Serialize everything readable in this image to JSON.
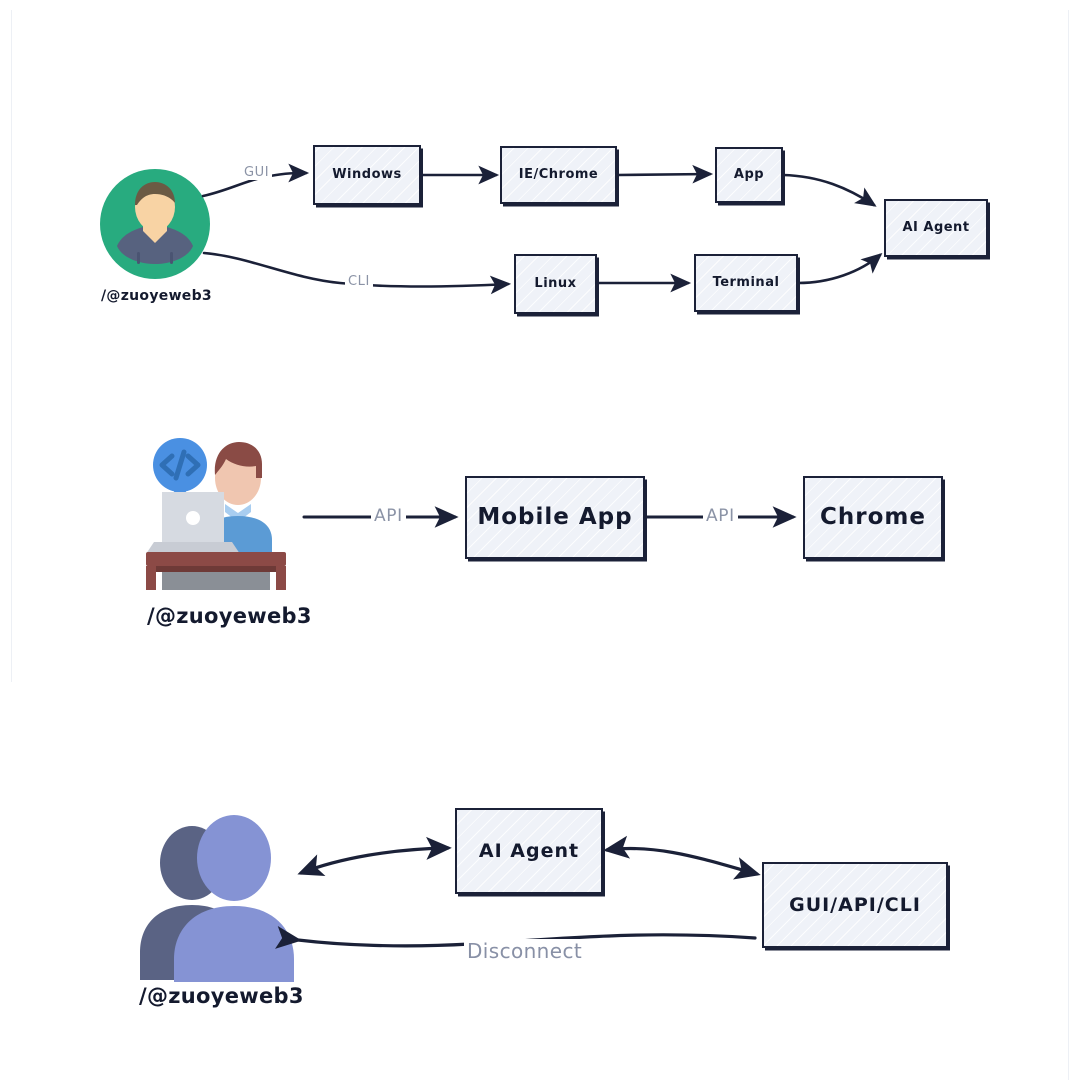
{
  "page": {
    "background": "#ffffff",
    "rail_color": "#edf0f5",
    "node_fill": "#eff2f8",
    "node_stroke": "#1b2138",
    "label_color": "#8b93a6",
    "text_color": "#141a2e"
  },
  "diagrams": [
    {
      "id": "gui-cli-flow",
      "avatar": {
        "type": "circle-user-avatar",
        "caption": "/@zuoyeweb3",
        "colors": {
          "circle": "#28ab7f",
          "hair": "#6b5a44",
          "skin": "#f8d3a4",
          "body": "#57627f"
        }
      },
      "nodes": [
        {
          "id": "windows",
          "label": "Windows"
        },
        {
          "id": "ie-chrome",
          "label": "IE/Chrome"
        },
        {
          "id": "app",
          "label": "App"
        },
        {
          "id": "linux",
          "label": "Linux"
        },
        {
          "id": "terminal",
          "label": "Terminal"
        },
        {
          "id": "ai-agent",
          "label": "AI Agent"
        }
      ],
      "edges": [
        {
          "from": "user",
          "to": "windows",
          "label": "GUI"
        },
        {
          "from": "windows",
          "to": "ie-chrome",
          "label": ""
        },
        {
          "from": "ie-chrome",
          "to": "app",
          "label": ""
        },
        {
          "from": "app",
          "to": "ai-agent",
          "label": ""
        },
        {
          "from": "user",
          "to": "linux",
          "label": "CLI"
        },
        {
          "from": "linux",
          "to": "terminal",
          "label": ""
        },
        {
          "from": "terminal",
          "to": "ai-agent",
          "label": ""
        }
      ]
    },
    {
      "id": "api-flow",
      "avatar": {
        "type": "developer-at-desk-avatar",
        "caption": "/@zuoyeweb3",
        "badge": "code-bubble-icon",
        "colors": {
          "bubble": "#4a90e2",
          "laptop": "#d6dae1",
          "desk": "#8c4a46",
          "shirt": "#5b9bd5",
          "hair": "#8a4b45",
          "skin": "#f0c6b0"
        }
      },
      "nodes": [
        {
          "id": "mobile-app",
          "label": "Mobile App"
        },
        {
          "id": "chrome",
          "label": "Chrome"
        }
      ],
      "edges": [
        {
          "from": "developer",
          "to": "mobile-app",
          "label": "API"
        },
        {
          "from": "mobile-app",
          "to": "chrome",
          "label": "API"
        }
      ]
    },
    {
      "id": "disconnect-flow",
      "avatar": {
        "type": "two-users-silhouette-avatar",
        "caption": "/@zuoyeweb3",
        "colors": {
          "back": "#5a6384",
          "front": "#8593d4"
        }
      },
      "nodes": [
        {
          "id": "ai-agent-2",
          "label": "AI Agent"
        },
        {
          "id": "gui-api-cli",
          "label": "GUI/API/CLI"
        }
      ],
      "edges": [
        {
          "from": "users",
          "to": "ai-agent-2",
          "label": "",
          "bidirectional": true
        },
        {
          "from": "ai-agent-2",
          "to": "gui-api-cli",
          "label": "",
          "bidirectional": true
        },
        {
          "from": "gui-api-cli",
          "to": "users",
          "label": "Disconnect"
        }
      ]
    }
  ]
}
